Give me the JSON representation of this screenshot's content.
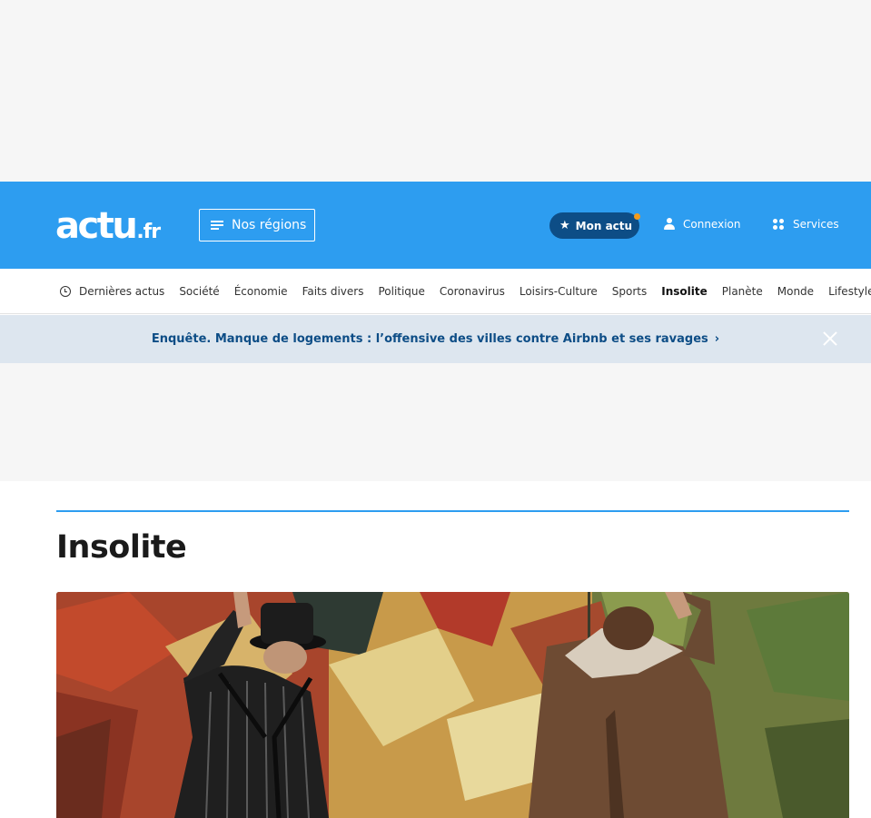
{
  "header": {
    "logo_main": "actu",
    "logo_tld": ".fr",
    "regions_label": "Nos régions",
    "mon_actu_label": "Mon actu",
    "connexion_label": "Connexion",
    "services_label": "Services",
    "background_color": "#2d9df0",
    "mon_actu_color": "#0d4d86",
    "notification_dot_color": "#f29b1d"
  },
  "nav": {
    "items": [
      {
        "label": "Dernières actus",
        "icon": "clock-icon"
      },
      {
        "label": "Société"
      },
      {
        "label": "Économie"
      },
      {
        "label": "Faits divers"
      },
      {
        "label": "Politique"
      },
      {
        "label": "Coronavirus"
      },
      {
        "label": "Loisirs-Culture"
      },
      {
        "label": "Sports"
      },
      {
        "label": "Insolite",
        "active": true
      },
      {
        "label": "Planète"
      },
      {
        "label": "Monde"
      },
      {
        "label": "Lifestyle"
      }
    ]
  },
  "banner": {
    "text": "Enquête. Manque de logements : l’offensive des villes contre Airbnb et ses ravages",
    "chevron": "›",
    "close_icon": "close-icon"
  },
  "main": {
    "title": "Insolite",
    "accent_color": "#2d9df0"
  }
}
